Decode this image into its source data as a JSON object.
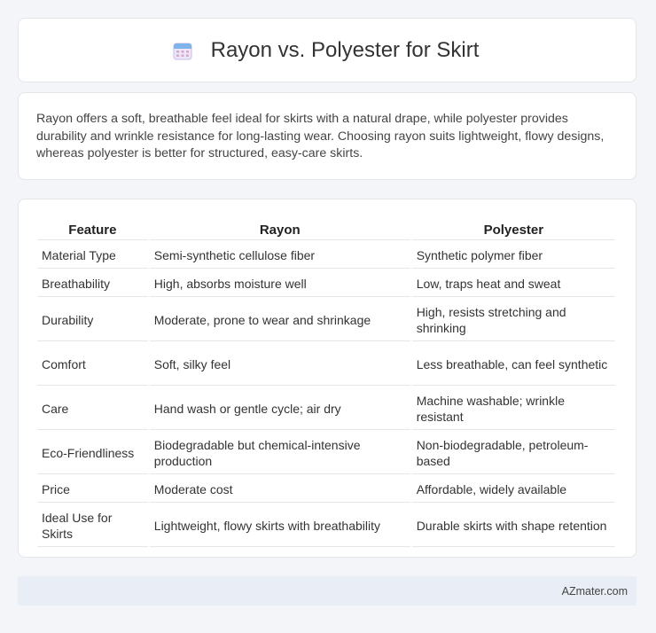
{
  "header": {
    "title": "Rayon vs. Polyester for Skirt",
    "icon": "calendar-icon"
  },
  "intro": {
    "text": "Rayon offers a soft, breathable feel ideal for skirts with a natural drape, while polyester provides durability and wrinkle resistance for long-lasting wear. Choosing rayon suits lightweight, flowy designs, whereas polyester is better for structured, easy-care skirts."
  },
  "table": {
    "headers": [
      "Feature",
      "Rayon",
      "Polyester"
    ],
    "rows": [
      [
        "Material Type",
        "Semi-synthetic cellulose fiber",
        "Synthetic polymer fiber"
      ],
      [
        "Breathability",
        "High, absorbs moisture well",
        "Low, traps heat and sweat"
      ],
      [
        "Durability",
        "Moderate, prone to wear and shrinkage",
        "High, resists stretching and shrinking"
      ],
      [
        "Comfort",
        "Soft, silky feel",
        "Less breathable, can feel synthetic"
      ],
      [
        "Care",
        "Hand wash or gentle cycle; air dry",
        "Machine washable; wrinkle resistant"
      ],
      [
        "Eco-Friendliness",
        "Biodegradable but chemical-intensive production",
        "Non-biodegradable, petroleum-based"
      ],
      [
        "Price",
        "Moderate cost",
        "Affordable, widely available"
      ],
      [
        "Ideal Use for Skirts",
        "Lightweight, flowy skirts with breathability",
        "Durable skirts with shape retention"
      ]
    ]
  },
  "footer": {
    "text": "AZmater.com"
  }
}
